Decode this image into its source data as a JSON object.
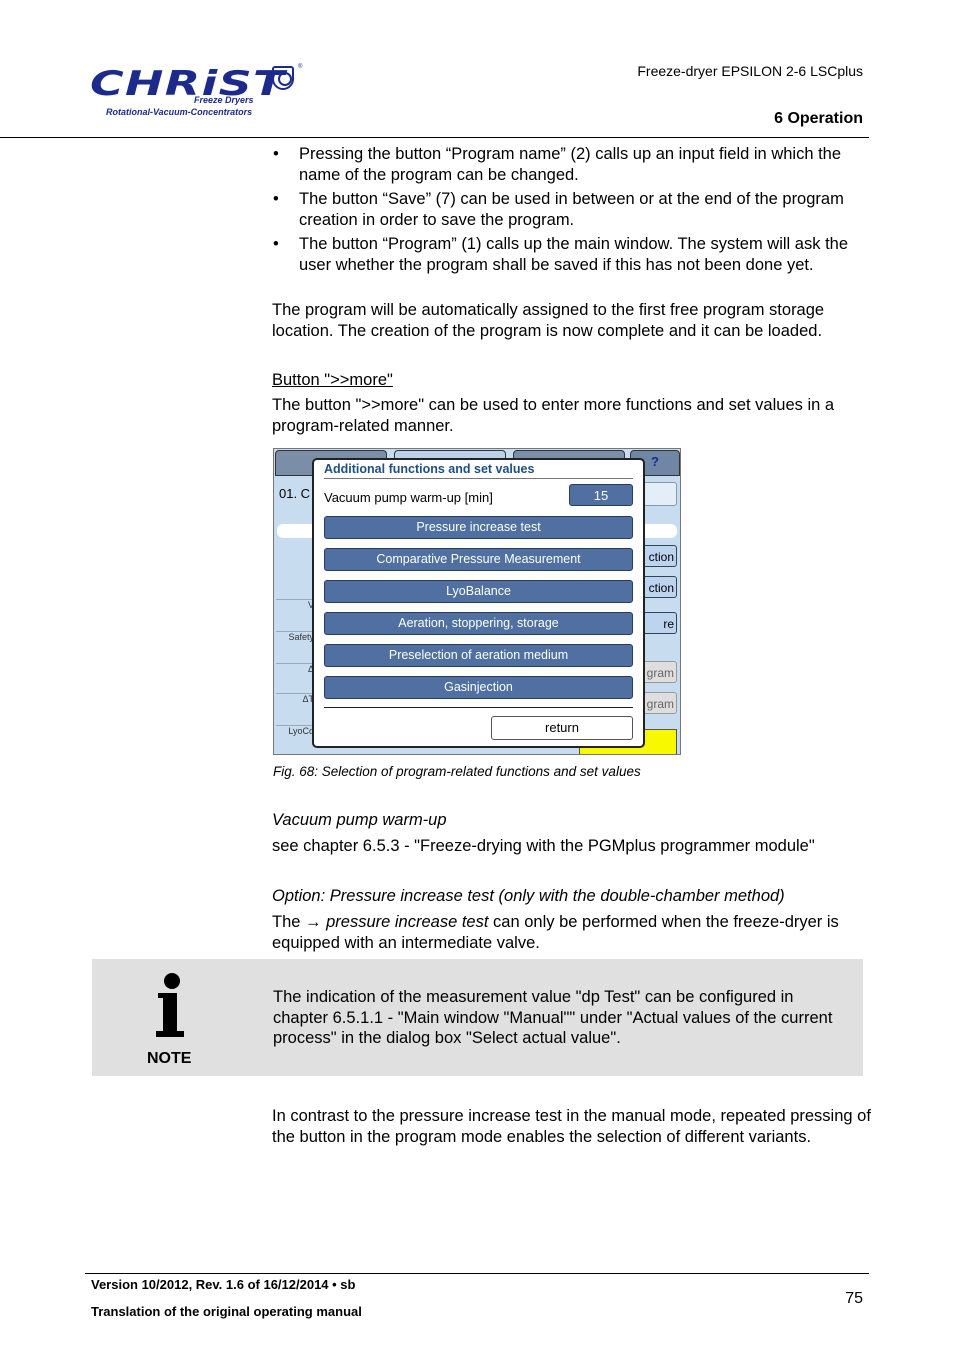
{
  "header": {
    "logo": {
      "wordmark": "CHRiST",
      "subtitle1": "Freeze Dryers",
      "subtitle2": "Rotational-Vacuum-Concentrators",
      "registered": "®"
    },
    "product": "Freeze-dryer EPSILON 2-6 LSCplus",
    "section": "6 Operation"
  },
  "bullets": [
    "Pressing the button “Program name” (2) calls up an input field in which the name of the program can be changed.",
    "The button “Save” (7) can be used in between or at the end of the program creation in order to save the program.",
    "The button “Program” (1) calls up the main window. The system will ask the user whether the program shall be saved if this has not been done yet."
  ],
  "para_auto_assign": "The program will be automatically assigned to the first free program storage location. The creation of the program is now complete and it can be loaded.",
  "more_heading": "Button \">>more\"",
  "more_text": "The button \">>more\" can be used to enter more functions and set values in a program-related manner.",
  "figure": {
    "background": {
      "help_tab": "?",
      "row_number": "01. C",
      "row_labels": [
        "V",
        "Safety",
        "Δ",
        "ΔT",
        "LyoCo"
      ],
      "right_buttons": [
        "ction",
        "ction",
        "re"
      ],
      "right_grey_buttons": [
        "gram",
        "gram"
      ]
    },
    "dialog": {
      "title": "Additional functions and set values",
      "warmup_label": "Vacuum pump warm-up [min]",
      "warmup_value": "15",
      "buttons": [
        "Pressure increase test",
        "Comparative Pressure Measurement",
        "LyoBalance",
        "Aeration, stoppering, storage",
        "Preselection of aeration medium",
        "Gasinjection"
      ],
      "return_label": "return"
    },
    "caption": "Fig. 68: Selection of program-related functions and set values"
  },
  "warmup_heading": "Vacuum pump warm-up",
  "warmup_text": "see chapter 6.5.3 - \"Freeze-drying with the PGMplus programmer module\"",
  "option_heading": "Option: Pressure increase test (only with the double-chamber method)",
  "option_text": {
    "prefix": "The ",
    "arrow": "→",
    "term": " pressure increase test",
    "suffix": " can only be performed when the freeze-dryer is equipped with an intermediate valve."
  },
  "note": {
    "label": "NOTE",
    "text": "The indication of the measurement value \"dp Test\" can be configured in chapter 6.5.1.1 - \"Main window \"Manual\"\" under \"Actual values of the current process\" in the dialog box \"Select actual value\"."
  },
  "contrast_text": "In contrast to the pressure increase test in the manual mode, repeated pressing of the button in the program mode enables the selection of different variants.",
  "footer": {
    "version": "Version 10/2012, Rev. 1.6 of 16/12/2014 • sb",
    "translation": "Translation of the original operating manual",
    "page": "75"
  }
}
